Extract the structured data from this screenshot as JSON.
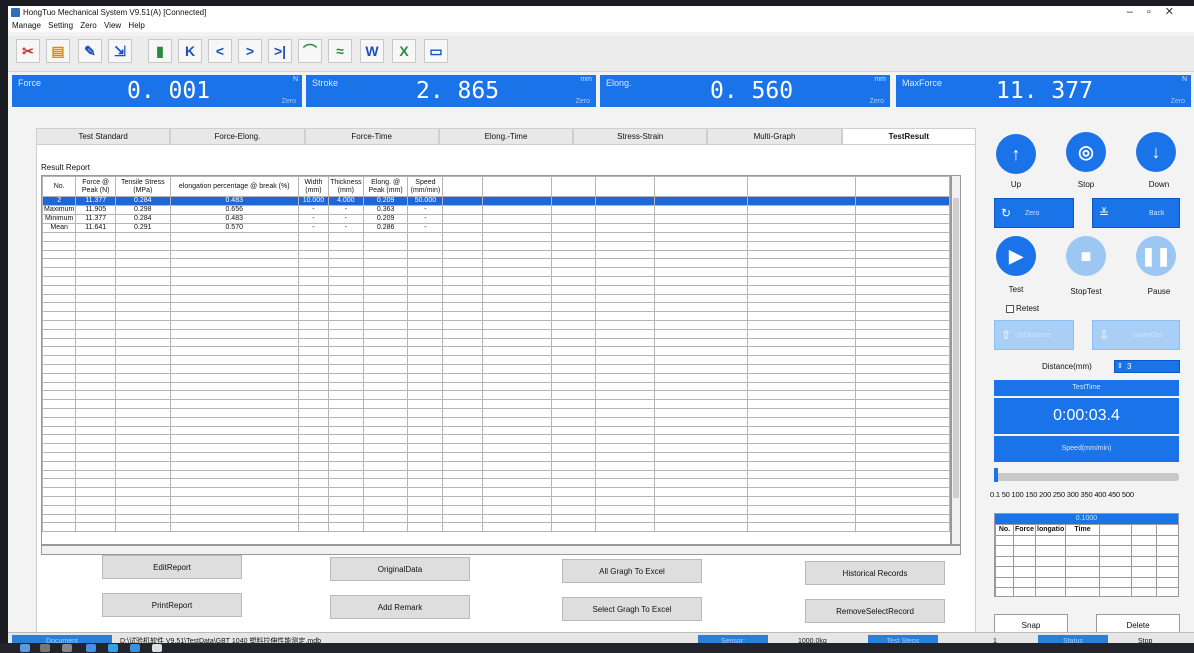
{
  "window": {
    "title": "HongTuo Mechanical System V9.51(A)  [Connected]",
    "controls": [
      "–",
      "▫",
      "✕"
    ]
  },
  "menu": [
    "Manage",
    "Setting",
    "Zero",
    "View",
    "Help"
  ],
  "toolbar": {
    "icons": [
      "scissors-icon",
      "folder-icon",
      "edit-icon",
      "export-icon",
      "trash-icon",
      "first-icon",
      "prev-icon",
      "next-icon",
      "last-icon",
      "curve-icon",
      "multicurve-icon",
      "word-icon",
      "excel-icon",
      "monitor-icon"
    ],
    "glyphs": [
      "✂",
      "▤",
      "✎",
      "⇲",
      "▮",
      "K",
      "<",
      ">",
      ">|",
      "⌒",
      "≈",
      "W",
      "X",
      "▭"
    ]
  },
  "readouts": {
    "force": {
      "label": "Force",
      "value": "0. 001",
      "unit": "N",
      "zero": "Zero"
    },
    "stroke": {
      "label": "Stroke",
      "value": "2. 865",
      "unit": "mm",
      "zero": "Zero"
    },
    "elong": {
      "label": "Elong.",
      "value": "0. 560",
      "unit": "mm",
      "zero": "Zero"
    },
    "maxforce": {
      "label": "MaxForce",
      "value": "11. 377",
      "unit": "N",
      "zero": "Zero"
    }
  },
  "tabs": [
    "Test Standard",
    "Force-Elong.",
    "Force-Time",
    "Elong.-Time",
    "Stress-Strain",
    "Multi-Graph",
    "TestResult"
  ],
  "report": {
    "title": "Result Report",
    "columns": [
      "No.",
      "Force @ Peak (N)",
      "Tensile Stress (MPa)",
      "elongation percentage @ break (%)",
      "Width (mm)",
      "Thickness (mm)",
      "Elong. @ Peak (mm)",
      "Speed (mm/min)"
    ],
    "rows": [
      [
        "2",
        "11.377",
        "0.284",
        "0.483",
        "10.000",
        "4.000",
        "0.209",
        "50.000"
      ],
      [
        "Maximum",
        "11.905",
        "0.298",
        "0.656",
        "-",
        "-",
        "0.363",
        "-"
      ],
      [
        "Minimum",
        "11.377",
        "0.284",
        "0.483",
        "-",
        "-",
        "0.209",
        "-"
      ],
      [
        "Mean",
        "11.641",
        "0.291",
        "0.570",
        "-",
        "-",
        "0.286",
        "-"
      ]
    ]
  },
  "buttons": {
    "edit_report": "EditReport",
    "original_data": "OriginalData",
    "all_graph": "All Gragh To Excel",
    "historical": "Historical Records",
    "print_report": "PrintReport",
    "add_remark": "Add Remark",
    "select_graph": "Select Gragh To Excel",
    "remove_select": "RemoveSelectRecord"
  },
  "side": {
    "up": "Up",
    "stop": "Stop",
    "down": "Down",
    "zero": "Zero",
    "back": "Back",
    "test": "Test",
    "stop_test": "StopTest",
    "pause": "Pause",
    "retest": "Retest",
    "up_distance": "UpDistance",
    "down_distance": "DownDist",
    "distance_label": "Distance(mm)",
    "distance_value": "3",
    "test_time_label": "TestTime",
    "test_time_value": "0:00:03.4",
    "speed_label": "Speed(mm/min)",
    "speed_ticks": "0.1  50  100 150 200 250 300 350 400 450 500",
    "speed_level": 0.0,
    "snap_header": "0.1000",
    "snap_columns": [
      "No.",
      "Force",
      "longatio",
      "Time"
    ],
    "snap": "Snap",
    "delete": "Delete"
  },
  "status": {
    "document_label": "Document",
    "file_path": "D:\\试验机软件 V9.51\\TestData\\GBT 1040 塑料拉伸性能测定.mdb",
    "sensor_label": "Sensor:",
    "sensor_value": "1000.0kg",
    "test_steps_label": "Test Steps",
    "test_steps_value": "1",
    "status_label": "Status",
    "status_value": "Stop"
  },
  "colors": {
    "accent": "#1a73e8",
    "selected_row": "#1f66d6"
  }
}
